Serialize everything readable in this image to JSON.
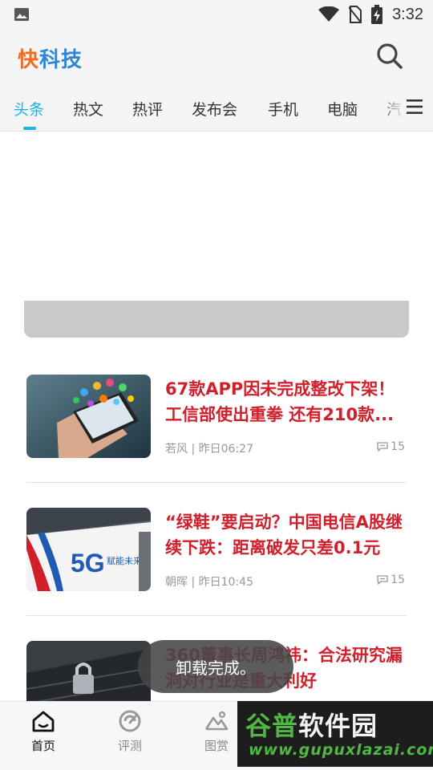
{
  "status_bar": {
    "time": "3:32"
  },
  "header": {
    "logo_part1": "快",
    "logo_part2": "科技"
  },
  "tabs": [
    "头条",
    "热文",
    "热评",
    "发布会",
    "手机",
    "电脑",
    "汽"
  ],
  "articles": [
    {
      "title": "67款APP因未完成整改下架！工信部使出重拳 还有210款...",
      "author": "若风",
      "time": "昨日06:27",
      "comments": "15"
    },
    {
      "title": "“绿鞋”要启动？中国电信A股继续下跌：距离破发只差0.1元",
      "author": "朝晖",
      "time": "昨日10:45",
      "comments": "15"
    },
    {
      "title": "360董事长周鸿祎：合法研究漏洞对行业是重大利好"
    }
  ],
  "thumb_texts": {
    "fiveg": "5G",
    "fiveg_slogan": "赋能未来"
  },
  "toast": "卸载完成。",
  "bottom_nav": [
    {
      "label": "首页",
      "icon": "home-icon"
    },
    {
      "label": "评测",
      "icon": "review-icon"
    },
    {
      "label": "图赏",
      "icon": "gallery-icon"
    }
  ],
  "watermark": {
    "title_green": "谷普",
    "title_white": "软件园",
    "url": "www.gupuxlazai.com"
  },
  "colors": {
    "accent": "#1ab2e8",
    "headline": "#d0202b",
    "logo_orange": "#f36b21",
    "logo_blue": "#2d86d6"
  }
}
